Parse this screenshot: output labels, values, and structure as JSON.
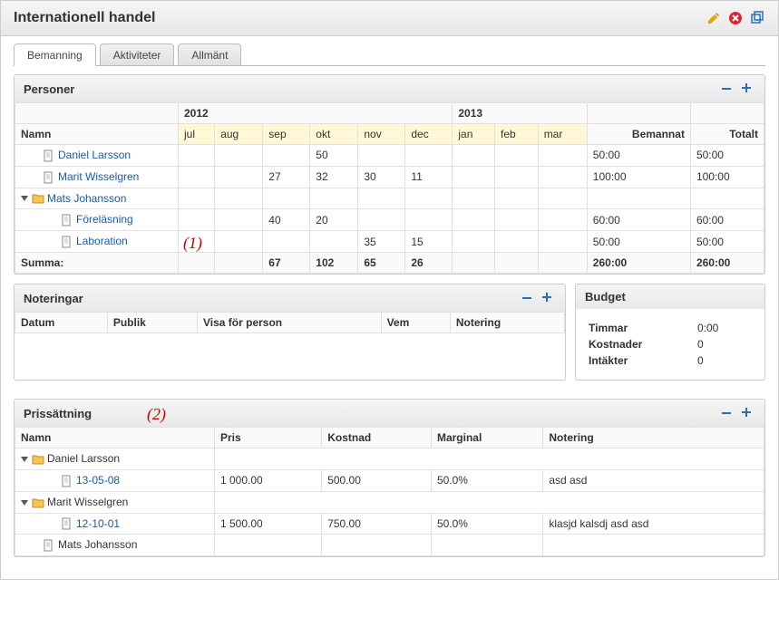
{
  "header": {
    "title": "Internationell handel",
    "icons": {
      "edit": "pencil-icon",
      "delete": "close-icon",
      "expand": "window-icon"
    }
  },
  "tabs": [
    {
      "label": "Bemanning",
      "active": true
    },
    {
      "label": "Aktiviteter",
      "active": false
    },
    {
      "label": "Allmänt",
      "active": false
    }
  ],
  "personer": {
    "title": "Personer",
    "year_groups": [
      {
        "label": "2012",
        "span": 6
      },
      {
        "label": "2013",
        "span": 3
      }
    ],
    "col_name": "Namn",
    "months": [
      "jul",
      "aug",
      "sep",
      "okt",
      "nov",
      "dec",
      "jan",
      "feb",
      "mar"
    ],
    "col_bemannat": "Bemannat",
    "col_totalt": "Totalt",
    "rows": [
      {
        "type": "leaf",
        "indent": 1,
        "name": "Daniel Larsson",
        "vals": [
          "",
          "",
          "",
          "50",
          "",
          "",
          "",
          "",
          ""
        ],
        "bemannat": "50:00",
        "totalt": "50:00"
      },
      {
        "type": "leaf",
        "indent": 1,
        "name": "Marit Wisselgren",
        "vals": [
          "",
          "",
          "27",
          "32",
          "30",
          "11",
          "",
          "",
          ""
        ],
        "bemannat": "100:00",
        "totalt": "100:00"
      },
      {
        "type": "group",
        "indent": 0,
        "name": "Mats Johansson",
        "vals": [
          "",
          "",
          "",
          "",
          "",
          "",
          "",
          "",
          ""
        ],
        "bemannat": "",
        "totalt": ""
      },
      {
        "type": "leaf",
        "indent": 2,
        "name": "Föreläsning",
        "vals": [
          "",
          "",
          "40",
          "20",
          "",
          "",
          "",
          "",
          ""
        ],
        "bemannat": "60:00",
        "totalt": "60:00"
      },
      {
        "type": "leaf",
        "indent": 2,
        "name": "Laboration",
        "vals": [
          "",
          "",
          "",
          "",
          "35",
          "15",
          "",
          "",
          ""
        ],
        "bemannat": "50:00",
        "totalt": "50:00"
      }
    ],
    "summa_label": "Summa:",
    "summa_vals": [
      "",
      "",
      "67",
      "102",
      "65",
      "26",
      "",
      "",
      ""
    ],
    "summa_bemannat": "260:00",
    "summa_totalt": "260:00"
  },
  "noteringar": {
    "title": "Noteringar",
    "cols": {
      "datum": "Datum",
      "publik": "Publik",
      "visa": "Visa för person",
      "vem": "Vem",
      "notering": "Notering"
    }
  },
  "budget": {
    "title": "Budget",
    "timmar_k": "Timmar",
    "timmar_v": "0:00",
    "kostnader_k": "Kostnader",
    "kostnader_v": "0",
    "intakter_k": "Intäkter",
    "intakter_v": "0"
  },
  "prissattning": {
    "title": "Prissättning",
    "cols": {
      "namn": "Namn",
      "pris": "Pris",
      "kostnad": "Kostnad",
      "marginal": "Marginal",
      "notering": "Notering"
    },
    "rows": [
      {
        "type": "group",
        "indent": 0,
        "name": "Daniel Larsson"
      },
      {
        "type": "leaf",
        "indent": 2,
        "name": "13-05-08",
        "pris": "1 000.00",
        "kostnad": "500.00",
        "marginal": "50.0%",
        "notering": "asd asd"
      },
      {
        "type": "group",
        "indent": 0,
        "name": "Marit Wisselgren"
      },
      {
        "type": "leaf",
        "indent": 2,
        "name": "12-10-01",
        "pris": "1 500.00",
        "kostnad": "750.00",
        "marginal": "50.0%",
        "notering": "klasjd kalsdj asd asd"
      },
      {
        "type": "leaf",
        "indent": 1,
        "name": "Mats Johansson",
        "pris": "",
        "kostnad": "",
        "marginal": "",
        "notering": ""
      }
    ]
  },
  "annotations": {
    "a1": "(1)",
    "a2": "(2)"
  }
}
